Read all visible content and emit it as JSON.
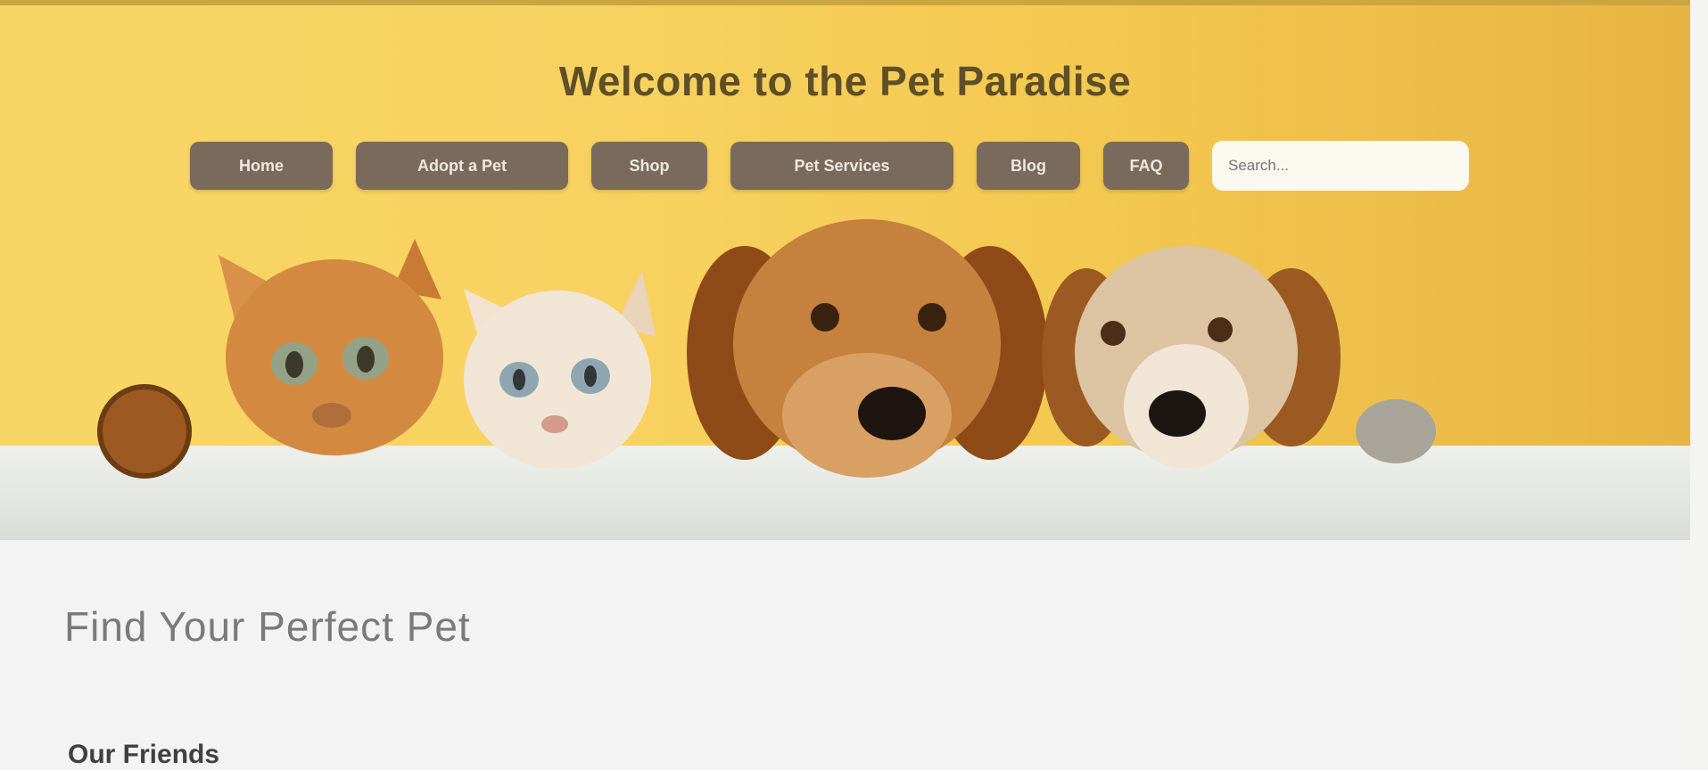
{
  "header": {
    "title": "Welcome to the Pet Paradise"
  },
  "nav": {
    "items": [
      {
        "label": "Home"
      },
      {
        "label": "Adopt a Pet"
      },
      {
        "label": "Shop"
      },
      {
        "label": "Pet Services"
      },
      {
        "label": "Blog"
      },
      {
        "label": "FAQ"
      }
    ],
    "search_placeholder": "Search..."
  },
  "main": {
    "heading": "Find Your Perfect Pet",
    "subheading": "Our Friends"
  },
  "colors": {
    "hero_yellow": "#f8d261",
    "nav_button": "#7a6a5c",
    "page_background": "#f3f3f3"
  }
}
